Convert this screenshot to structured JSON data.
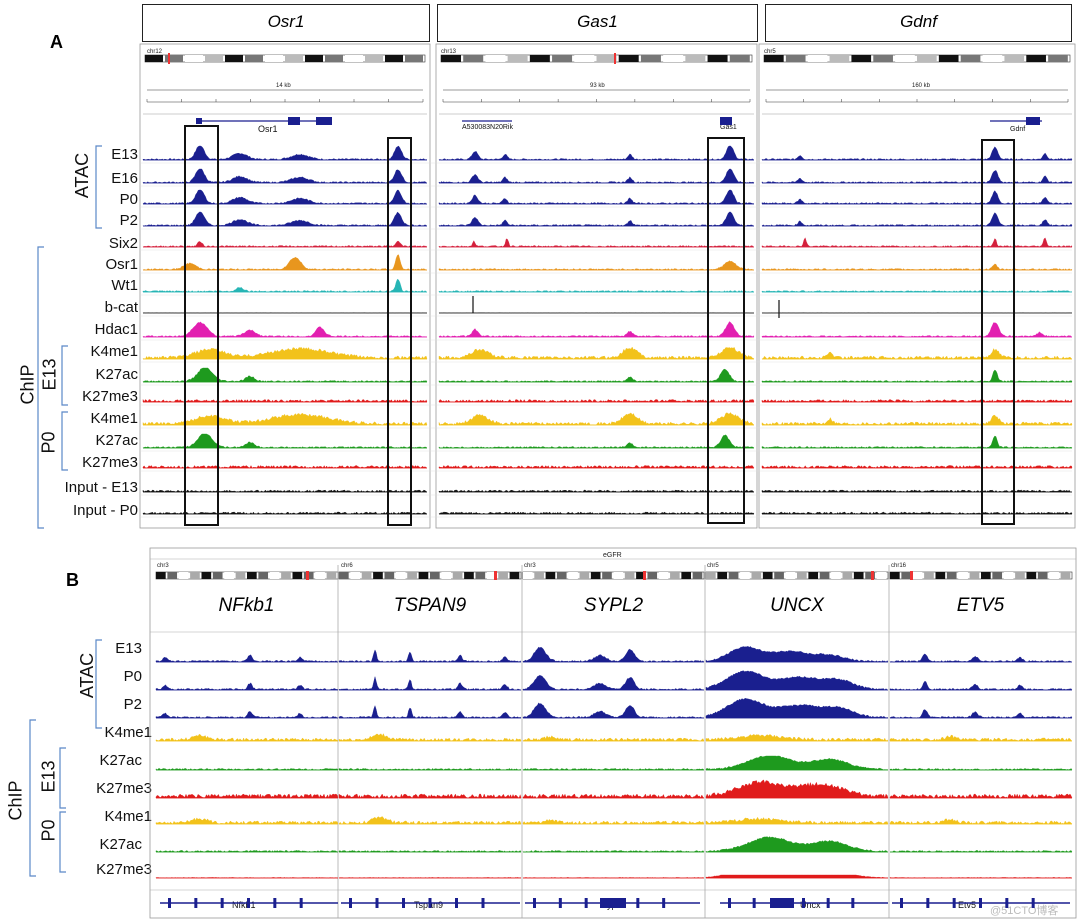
{
  "panelA": {
    "label": "A",
    "genes": [
      "Osr1",
      "Gas1",
      "Gdnf"
    ],
    "chromosomes": [
      "chr12",
      "chr13",
      "chr5"
    ],
    "scales": [
      "14 kb",
      "93 kb",
      "160 kb"
    ],
    "gene_annotations": [
      "Osr1",
      "A530083N20Rik",
      "Gas1",
      "Gdnf"
    ],
    "track_labels": [
      "E13",
      "E16",
      "P0",
      "P2",
      "Six2",
      "Osr1",
      "Wt1",
      "b-cat",
      "Hdac1",
      "K4me1",
      "K27ac",
      "K27me3",
      "K4me1",
      "K27ac",
      "K27me3",
      "Input - E13",
      "Input - P0"
    ],
    "groups": {
      "atac": "ATAC",
      "chip": "ChIP",
      "e13": "E13",
      "p0": "P0"
    }
  },
  "panelB": {
    "label": "B",
    "header": "eGFR",
    "genes": [
      "NFkb1",
      "TSPAN9",
      "SYPL2",
      "UNCX",
      "ETV5"
    ],
    "chromosomes": [
      "chr3",
      "chr6",
      "chr3",
      "chr5",
      "chr16"
    ],
    "gene_annotations": [
      "Nfkb1",
      "Tspan9",
      "Sypl2",
      "Uncx",
      "Etv5"
    ],
    "track_labels": [
      "E13",
      "P0",
      "P2",
      "K4me1",
      "K27ac",
      "K27me3",
      "K4me1",
      "K27ac",
      "K27me3"
    ],
    "groups": {
      "atac": "ATAC",
      "chip": "ChIP",
      "e13": "E13",
      "p0": "P0"
    }
  },
  "colors": {
    "atac": "#1a1f8f",
    "six2": "#d4203c",
    "osr1": "#e8961e",
    "wt1": "#26b5b5",
    "bcat": "#222222",
    "hdac1": "#e21fb0",
    "k4me1": "#f2c21b",
    "k27ac": "#1e9a1e",
    "k27me3": "#e01b1b",
    "input": "#111111",
    "bracket": "#5b88c8"
  },
  "watermark": "@51CTO博客"
}
